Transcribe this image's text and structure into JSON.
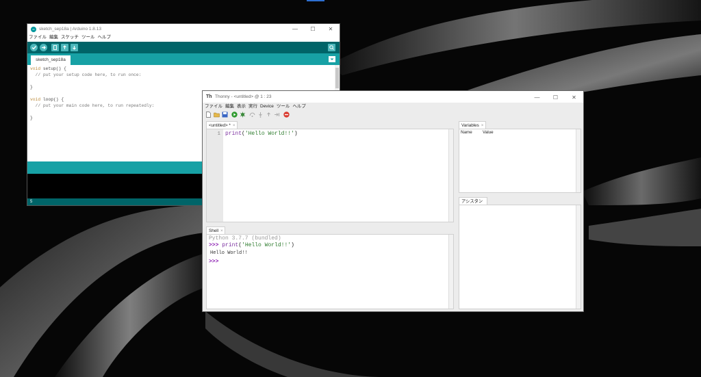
{
  "arduino": {
    "title": "sketch_sep18a | Arduino 1.8.13",
    "menu": [
      "ファイル",
      "編集",
      "スケッチ",
      "ツール",
      "ヘルプ"
    ],
    "tab": "sketch_sep18a",
    "code": {
      "setup_kw": "void",
      "setup_rest": " setup() {",
      "setup_comment": "  // put your setup code here, to run once:",
      "close1": "}",
      "loop_kw": "void",
      "loop_rest": " loop() {",
      "loop_comment": "  // put your main code here, to run repeatedly:",
      "close2": "}"
    },
    "footer_line": "5"
  },
  "thonny": {
    "title": "Thonny  -  <untitled>  @  1 : 23",
    "menu": [
      "ファイル",
      "編集",
      "表示",
      "実行",
      "Device",
      "ツール",
      "ヘルプ"
    ],
    "editor": {
      "tab_label": "<untitled> *",
      "line_number": "1",
      "code_fn": "print",
      "code_open": "(",
      "code_str": "'Hello World!!'",
      "code_close": ")"
    },
    "shell": {
      "tab_label": "Shell",
      "version": "Python 3.7.7 (bundled)",
      "prompt": ">>>",
      "cmd_fn": "print",
      "cmd_open": "(",
      "cmd_str": "'Hello World!!'",
      "cmd_close": ")",
      "output": "Hello World!!"
    },
    "variables": {
      "tab_label": "Variables",
      "col_name": "Name",
      "col_value": "Value"
    },
    "assistant": {
      "tab_label": "アシスタント"
    }
  },
  "colors": {
    "arduino_dark": "#006468",
    "arduino_teal": "#17a1a5",
    "thonny_prompt": "#8a1bb0"
  }
}
